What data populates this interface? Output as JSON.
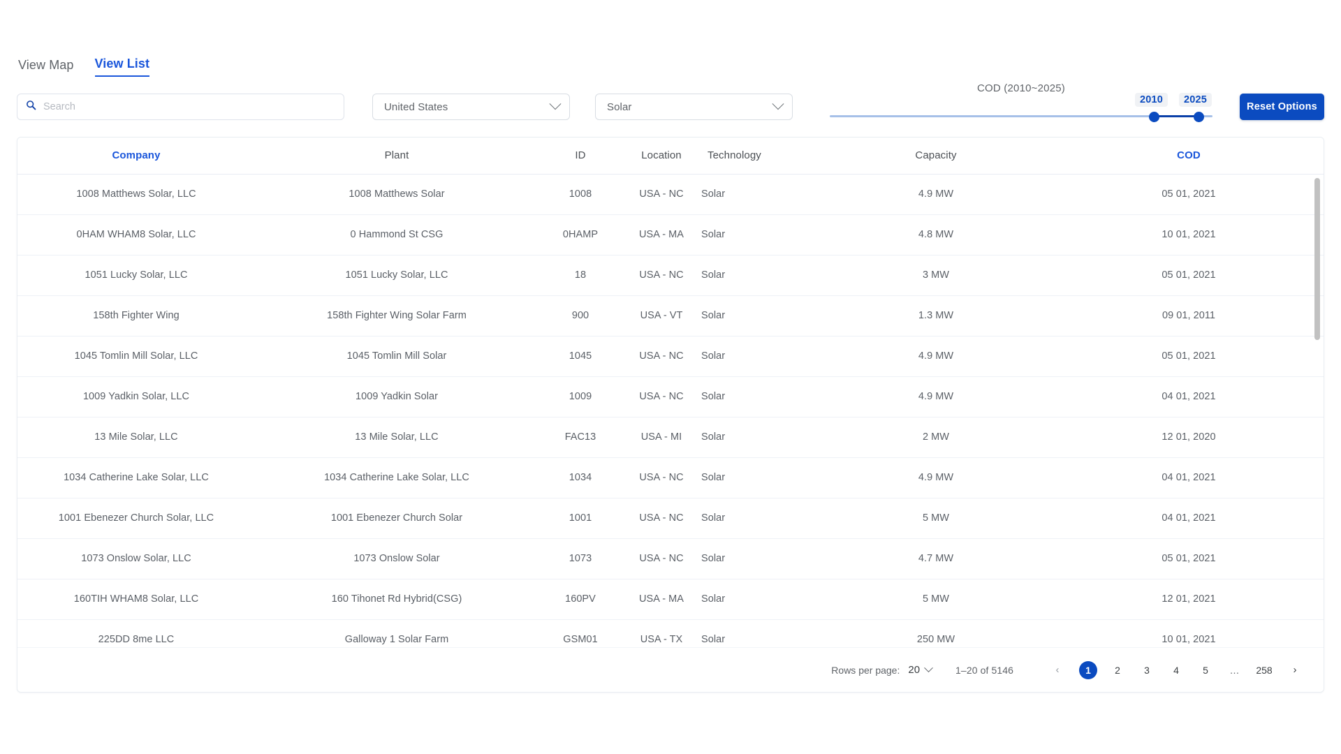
{
  "tabs": [
    {
      "label": "View Map",
      "active": false
    },
    {
      "label": "View List",
      "active": true
    }
  ],
  "search": {
    "value": "",
    "placeholder": "Search",
    "icon": "search-icon"
  },
  "filters": {
    "country": {
      "value": "United States"
    },
    "technology": {
      "value": "Solar"
    }
  },
  "slider": {
    "label": "COD (2010~2025)",
    "min_value": "2010",
    "max_value": "2025"
  },
  "reset_button": {
    "label": "Reset Options"
  },
  "table": {
    "columns": [
      {
        "key": "company",
        "label": "Company",
        "sorted": true
      },
      {
        "key": "plant",
        "label": "Plant",
        "sorted": false
      },
      {
        "key": "id",
        "label": "ID",
        "sorted": false
      },
      {
        "key": "location",
        "label": "Location",
        "sorted": false
      },
      {
        "key": "technology",
        "label": "Technology",
        "sorted": false
      },
      {
        "key": "capacity",
        "label": "Capacity",
        "sorted": false
      },
      {
        "key": "cod",
        "label": "COD",
        "sorted": true
      }
    ],
    "rows": [
      {
        "company": "1008 Matthews Solar, LLC",
        "plant": "1008 Matthews Solar",
        "id": "1008",
        "location": "USA - NC",
        "technology": "Solar",
        "capacity": "4.9 MW",
        "cod": "05 01, 2021"
      },
      {
        "company": "0HAM WHAM8 Solar, LLC",
        "plant": "0 Hammond St CSG",
        "id": "0HAMP",
        "location": "USA - MA",
        "technology": "Solar",
        "capacity": "4.8 MW",
        "cod": "10 01, 2021"
      },
      {
        "company": "1051 Lucky Solar, LLC",
        "plant": "1051 Lucky Solar, LLC",
        "id": "18",
        "location": "USA - NC",
        "technology": "Solar",
        "capacity": "3 MW",
        "cod": "05 01, 2021"
      },
      {
        "company": "158th Fighter Wing",
        "plant": "158th Fighter Wing Solar Farm",
        "id": "900",
        "location": "USA - VT",
        "technology": "Solar",
        "capacity": "1.3 MW",
        "cod": "09 01, 2011"
      },
      {
        "company": "1045 Tomlin Mill Solar, LLC",
        "plant": "1045 Tomlin Mill Solar",
        "id": "1045",
        "location": "USA - NC",
        "technology": "Solar",
        "capacity": "4.9 MW",
        "cod": "05 01, 2021"
      },
      {
        "company": "1009 Yadkin Solar, LLC",
        "plant": "1009 Yadkin Solar",
        "id": "1009",
        "location": "USA - NC",
        "technology": "Solar",
        "capacity": "4.9 MW",
        "cod": "04 01, 2021"
      },
      {
        "company": "13 Mile Solar, LLC",
        "plant": "13 Mile Solar, LLC",
        "id": "FAC13",
        "location": "USA - MI",
        "technology": "Solar",
        "capacity": "2 MW",
        "cod": "12 01, 2020"
      },
      {
        "company": "1034 Catherine Lake Solar, LLC",
        "plant": "1034 Catherine Lake Solar, LLC",
        "id": "1034",
        "location": "USA - NC",
        "technology": "Solar",
        "capacity": "4.9 MW",
        "cod": "04 01, 2021"
      },
      {
        "company": "1001 Ebenezer Church Solar, LLC",
        "plant": "1001 Ebenezer Church Solar",
        "id": "1001",
        "location": "USA - NC",
        "technology": "Solar",
        "capacity": "5 MW",
        "cod": "04 01, 2021"
      },
      {
        "company": "1073 Onslow Solar, LLC",
        "plant": "1073 Onslow Solar",
        "id": "1073",
        "location": "USA - NC",
        "technology": "Solar",
        "capacity": "4.7 MW",
        "cod": "05 01, 2021"
      },
      {
        "company": "160TIH WHAM8 Solar, LLC",
        "plant": "160 Tihonet Rd Hybrid(CSG)",
        "id": "160PV",
        "location": "USA - MA",
        "technology": "Solar",
        "capacity": "5 MW",
        "cod": "12 01, 2021"
      },
      {
        "company": "225DD 8me LLC",
        "plant": "Galloway 1 Solar Farm",
        "id": "GSM01",
        "location": "USA - TX",
        "technology": "Solar",
        "capacity": "250 MW",
        "cod": "10 01, 2021"
      }
    ]
  },
  "pagination": {
    "rows_per_page_label": "Rows per page:",
    "rows_per_page_value": "20",
    "range_text": "1–20 of 5146",
    "prev": "‹",
    "next": "›",
    "pages": [
      {
        "label": "1",
        "active": true,
        "type": "page"
      },
      {
        "label": "2",
        "active": false,
        "type": "page"
      },
      {
        "label": "3",
        "active": false,
        "type": "page"
      },
      {
        "label": "4",
        "active": false,
        "type": "page"
      },
      {
        "label": "5",
        "active": false,
        "type": "page"
      },
      {
        "label": "…",
        "active": false,
        "type": "ellipsis"
      },
      {
        "label": "258",
        "active": false,
        "type": "page"
      }
    ]
  },
  "colors": {
    "accent": "#0b4bc0",
    "link": "#1a56db",
    "text": "#5a5f66",
    "border": "#eef1f7"
  }
}
